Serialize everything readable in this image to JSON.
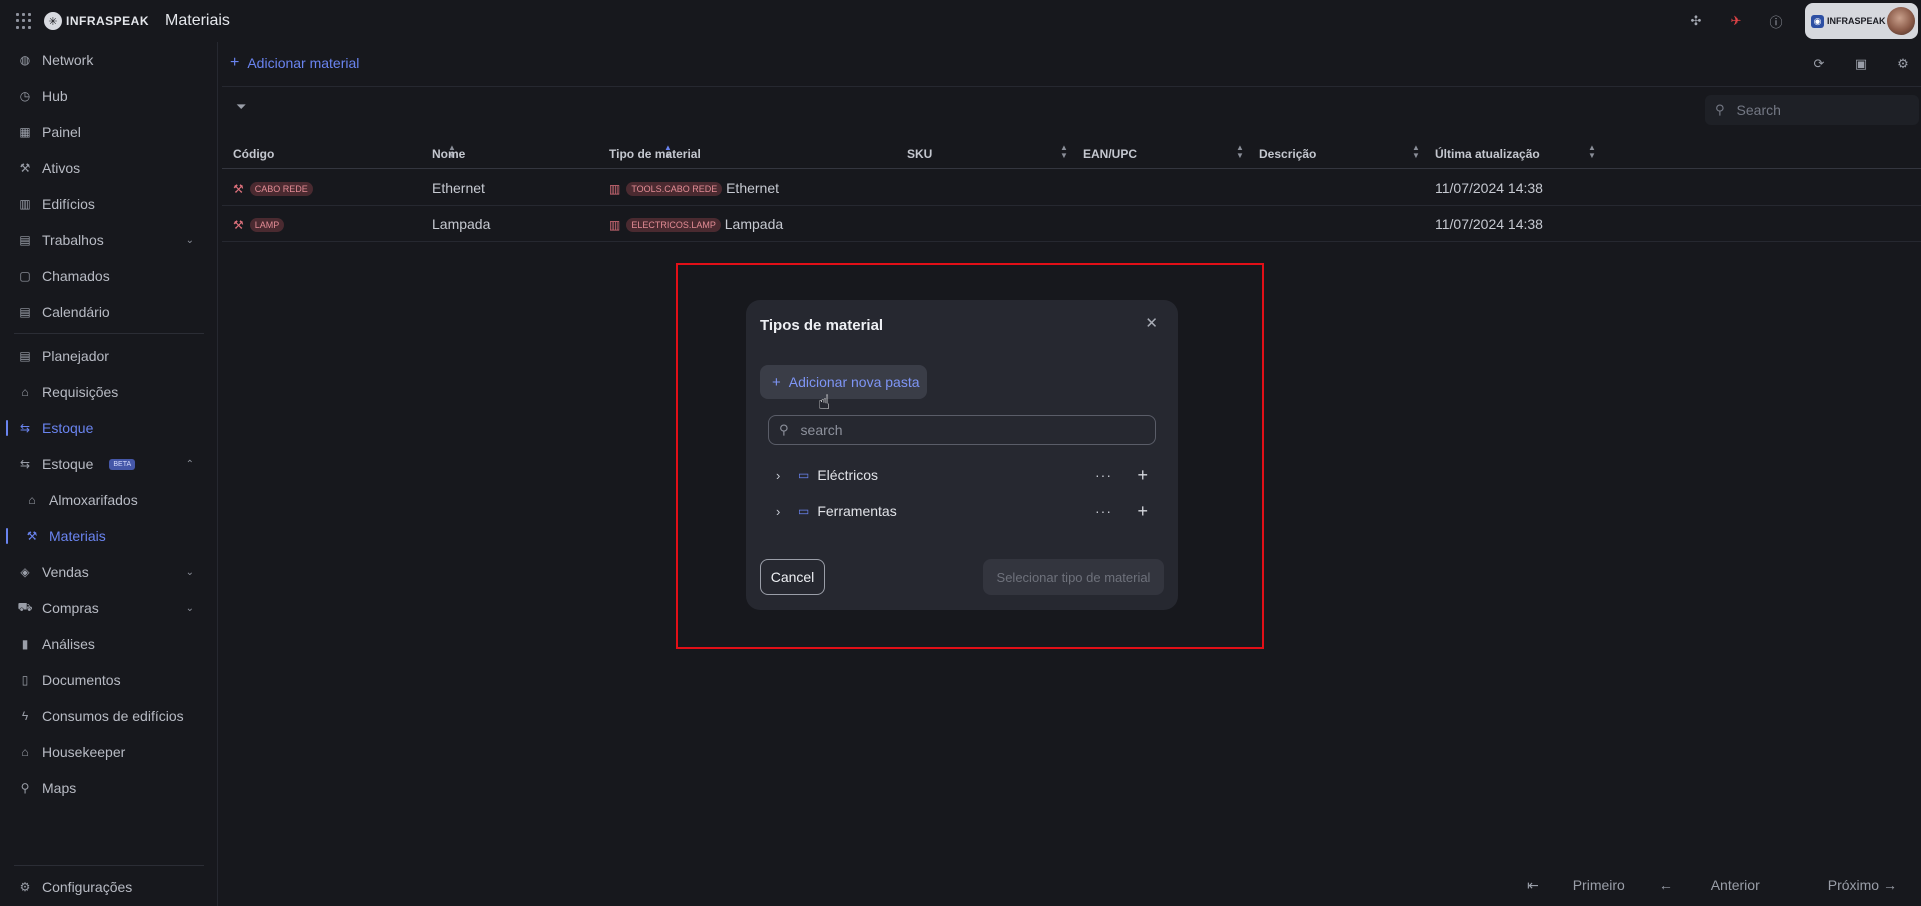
{
  "app": {
    "logo_text": "INFRASPEAK",
    "page_title": "Materiais"
  },
  "account": {
    "logo_text": "INFRASPEAK"
  },
  "sidebar": {
    "items": [
      {
        "label": "Network",
        "icon": "globe-icon"
      },
      {
        "label": "Hub",
        "icon": "clock-icon"
      },
      {
        "label": "Painel",
        "icon": "dashboard-icon"
      },
      {
        "label": "Ativos",
        "icon": "tool-icon"
      },
      {
        "label": "Edifícios",
        "icon": "building-icon"
      },
      {
        "label": "Trabalhos",
        "icon": "calendar-icon"
      },
      {
        "label": "Chamados",
        "icon": "clipboard-icon"
      },
      {
        "label": "Calendário",
        "icon": "calendar-icon"
      },
      {
        "label": "Planejador",
        "icon": "calendar-icon"
      },
      {
        "label": "Requisições",
        "icon": "bell-icon"
      },
      {
        "label": "Estoque",
        "icon": "stock-icon"
      },
      {
        "label": "Estoque",
        "icon": "stock-icon",
        "badge": "BETA"
      },
      {
        "label": "Almoxarifados",
        "icon": "warehouse-icon"
      },
      {
        "label": "Materiais",
        "icon": "wrench-icon"
      },
      {
        "label": "Vendas",
        "icon": "tag-icon"
      },
      {
        "label": "Compras",
        "icon": "cart-icon"
      },
      {
        "label": "Análises",
        "icon": "chart-icon"
      },
      {
        "label": "Documentos",
        "icon": "document-icon"
      },
      {
        "label": "Consumos de edifícios",
        "icon": "bolt-icon"
      },
      {
        "label": "Housekeeper",
        "icon": "house-icon"
      },
      {
        "label": "Maps",
        "icon": "pin-icon"
      }
    ],
    "settings_label": "Configurações"
  },
  "toolbar": {
    "add_material_label": "Adicionar material"
  },
  "table": {
    "search_placeholder": "Search",
    "columns": [
      "Código",
      "Nome",
      "Tipo de material",
      "SKU",
      "EAN/UPC",
      "Descrição",
      "Última atualização"
    ],
    "rows": [
      {
        "code": "CABO REDE",
        "name": "Ethernet",
        "type_code": "TOOLS.CABO REDE",
        "type_name": "Ethernet",
        "sku": "",
        "ean": "",
        "description": "",
        "updated": "11/07/2024 14:38"
      },
      {
        "code": "LAMP",
        "name": "Lampada",
        "type_code": "ELECTRICOS.LAMP",
        "type_name": "Lampada",
        "sku": "",
        "ean": "",
        "description": "",
        "updated": "11/07/2024 14:38"
      }
    ]
  },
  "pagination": {
    "first": "Primeiro",
    "prev": "Anterior",
    "next": "Próximo"
  },
  "modal": {
    "title": "Tipos de material",
    "add_folder_label": "Adicionar nova pasta",
    "search_placeholder": "search",
    "folders": [
      {
        "name": "Eléctricos"
      },
      {
        "name": "Ferramentas"
      }
    ],
    "cancel_label": "Cancel",
    "select_label": "Selecionar tipo de material"
  },
  "colors": {
    "accent": "#6a84f0",
    "highlight": "#e20f17",
    "pill_bg": "#4a2a30",
    "pill_text": "#e38c95"
  }
}
